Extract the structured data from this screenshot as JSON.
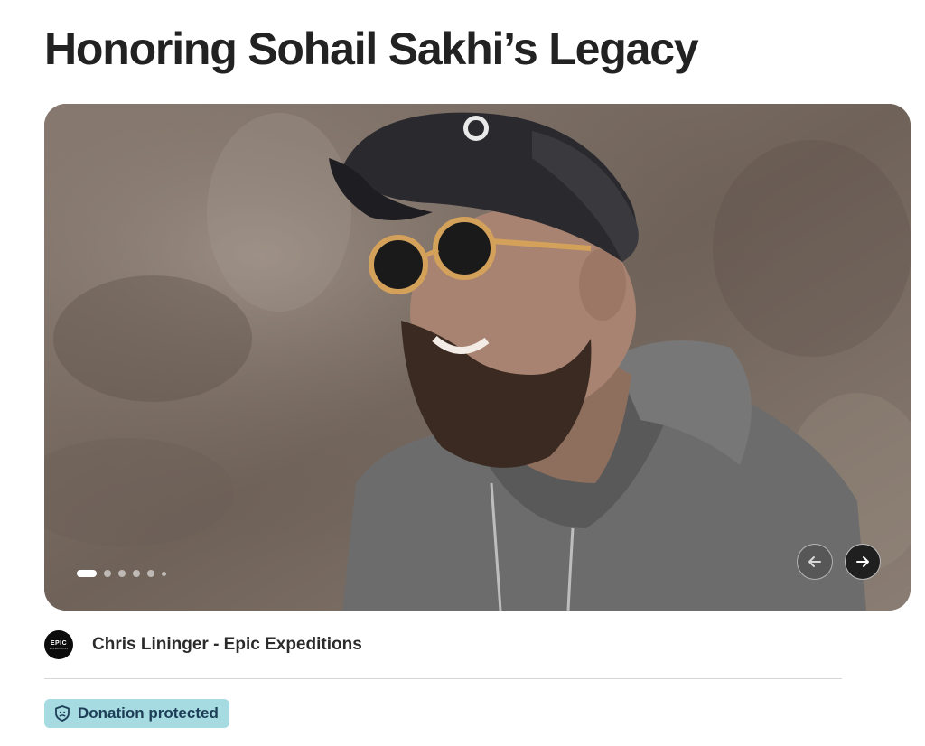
{
  "page": {
    "title": "Honoring Sohail Sakhi’s Legacy"
  },
  "hero": {
    "slide_count": 6,
    "active_slide": 1
  },
  "organizer": {
    "name": "Chris Lininger - Epic Expeditions",
    "avatar_text": "EPIC",
    "avatar_subtext": "EXPEDITIONS"
  },
  "badge": {
    "label": "Donation protected",
    "icon": "shield-icon"
  },
  "colors": {
    "badge_bg": "#a6dbe2",
    "badge_text": "#1e3e58",
    "title": "#222222"
  }
}
